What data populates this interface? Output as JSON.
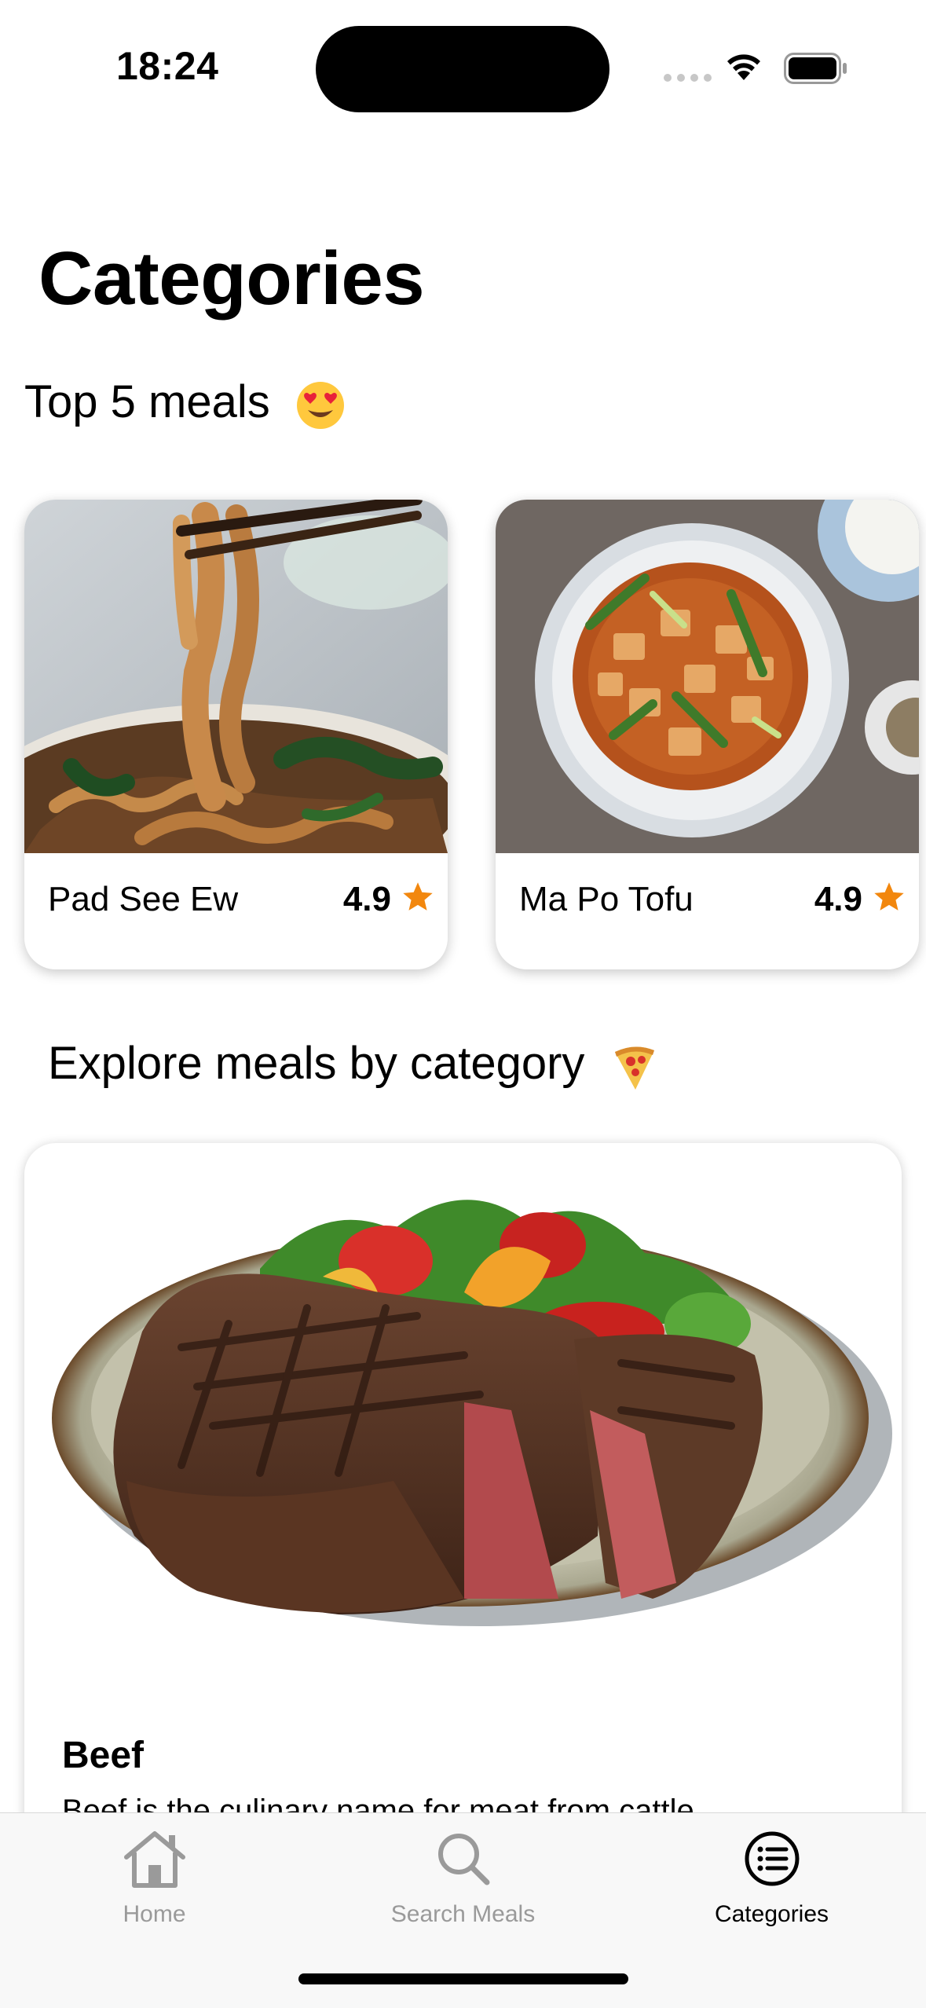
{
  "status_bar": {
    "time": "18:24"
  },
  "header": {
    "title": "Categories"
  },
  "top_meals": {
    "title": "Top 5 meals",
    "emoji": "smiling-face-with-heart-eyes",
    "items": [
      {
        "name": "Pad See Ew",
        "rating": "4.9"
      },
      {
        "name": "Ma Po Tofu",
        "rating": "4.9"
      }
    ]
  },
  "explore": {
    "title": "Explore meals by category",
    "emoji": "pizza",
    "categories": [
      {
        "name": "Beef",
        "description": "Beef is the culinary name for meat from cattle"
      }
    ]
  },
  "tab_bar": {
    "tabs": [
      {
        "label": "Home",
        "icon": "home-icon",
        "active": false
      },
      {
        "label": "Search Meals",
        "icon": "search-icon",
        "active": false
      },
      {
        "label": "Categories",
        "icon": "list-icon",
        "active": true
      }
    ]
  },
  "colors": {
    "accent_star": "#F2870E",
    "inactive_tab": "#9A9A9A"
  }
}
